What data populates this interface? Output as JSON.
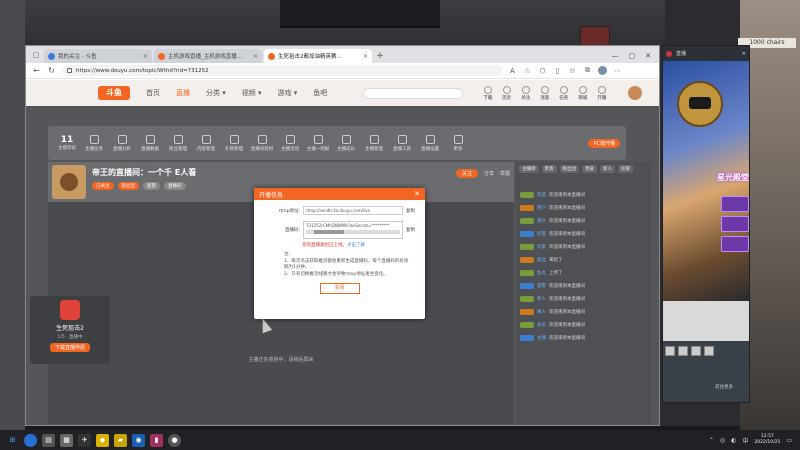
{
  "browser": {
    "tabs": [
      {
        "title": "我的关注 - 斗鱼",
        "active": false
      },
      {
        "title": "主机游戏直播_主机游戏直播...",
        "active": false
      },
      {
        "title": "生死狙击2都加油精英赛...",
        "active": true
      }
    ],
    "url": "https://www.douyu.com/topic/Wthd?rid=731252"
  },
  "site": {
    "logo": "斗鱼",
    "nav": [
      "首页",
      "直播",
      "分类 ▾",
      "视频 ▾",
      "游戏 ▾",
      "鱼吧"
    ],
    "nav_active_index": 1,
    "header_icons": [
      "下载",
      "历史",
      "关注",
      "消息",
      "任务",
      "商城",
      "开播"
    ]
  },
  "toolstrip": {
    "stat_value": "11",
    "stat_label": "主播等级",
    "items": [
      "主播任务",
      "直播分析",
      "直播数据",
      "粉丝管理",
      "内容管理",
      "礼物管理",
      "直播间装扮",
      "主播活动",
      "主播一周报",
      "主播成长",
      "主播管理",
      "直播工具",
      "直播设置",
      "更多"
    ],
    "pc_badge": "PC端开播"
  },
  "room": {
    "title": "帝王的直播间：一个千 E人看",
    "tags": [
      "已关注",
      "粉丝团",
      "超管",
      "直播间"
    ],
    "follow_label": "关注",
    "share_label": "分享",
    "report_label": "举报",
    "waiting_text": "主播正在收拾中，请稍后再来",
    "anchor_name": "生死狙击2",
    "anchor_stat": "1/5 · 直播中",
    "anchor_button": "下载直播伴侣"
  },
  "chat": {
    "tabs": [
      "主播榜",
      "贵宾",
      "粉丝团",
      "贵族",
      "新人",
      "房管"
    ],
    "rows": [
      {
        "user": "欢迎",
        "msg": "欢迎来到本直播间"
      },
      {
        "user": "用户",
        "msg": "欢迎来到本直播间"
      },
      {
        "user": "观众",
        "msg": "欢迎来到本直播间"
      },
      {
        "user": "房管",
        "msg": "欢迎来到本直播间"
      },
      {
        "user": "玩家",
        "msg": "欢迎来到本直播间"
      },
      {
        "user": "粉丝",
        "msg": "来玩了"
      },
      {
        "user": "鱼丸",
        "msg": "上传了"
      },
      {
        "user": "游客",
        "msg": "欢迎来到本直播间"
      },
      {
        "user": "新人",
        "msg": "欢迎来到本直播间"
      },
      {
        "user": "路人",
        "msg": "欢迎来到本直播间"
      },
      {
        "user": "会员",
        "msg": "欢迎来到本直播间"
      },
      {
        "user": "主播",
        "msg": "欢迎来到本直播间"
      }
    ]
  },
  "modal": {
    "title": "开播信息",
    "rtmp_label": "rtmp地址:",
    "rtmp_value": "rtmp://sendtc3a.douyu.com/live",
    "key_label": "直播码:",
    "key_value": "731252rCMhQNWM4?wsSecret=*********",
    "copy_label": "复制",
    "warning": "您的直播类别已上线，",
    "warning_link": "点击了解",
    "note_head": "注：",
    "notes": [
      "1、每次点击获取推流都会重新生成直播码，每个直播码的有效期为1分钟。",
      "2、只有切换推流线路才会导致rtmp地址发生变化。"
    ],
    "close_label": "关闭"
  },
  "sidewin": {
    "title": "直播",
    "promo": "星光殿堂",
    "footer": "前往更多"
  },
  "desktop": {
    "chairs_text": "1000 chairs"
  },
  "taskbar": {
    "time": "12:57",
    "date": "2022/10/25"
  }
}
